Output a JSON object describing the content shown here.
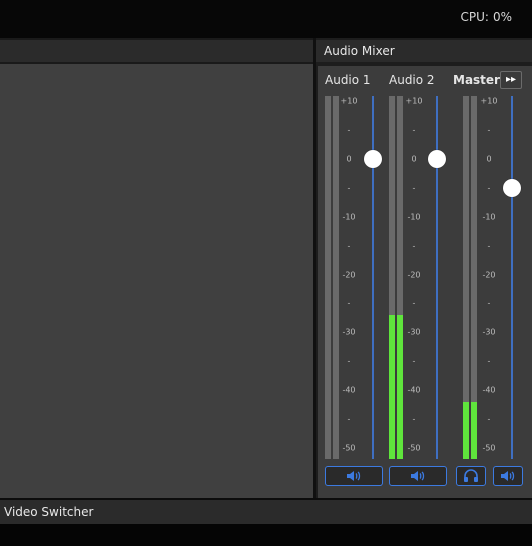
{
  "topbar": {
    "cpu_label": "CPU:",
    "cpu_value": "0%"
  },
  "mixer": {
    "title": "Audio Mixer",
    "expand_icon": "double-chevron-right-icon",
    "scale_labels": [
      "+10",
      "-",
      "0",
      "-",
      "-10",
      "-",
      "-20",
      "-",
      "-30",
      "-",
      "-40",
      "-",
      "-50"
    ],
    "channels": [
      {
        "label": "Audio 1",
        "level_db": -60,
        "fader_db": 0,
        "button_icon": "speaker-icon"
      },
      {
        "label": "Audio 2",
        "level_db": -27,
        "fader_db": 0,
        "button_icon": "speaker-icon"
      },
      {
        "label": "Master",
        "level_db": -42,
        "fader_db": -5,
        "buttons": [
          "headphones-icon",
          "speaker-icon"
        ]
      }
    ]
  },
  "bottom": {
    "video_switcher_title": "Video Switcher"
  },
  "colors": {
    "meter_green": "#5fe53c",
    "fader_track_blue": "#3f6fc1",
    "button_border_blue": "#3c7ae0"
  }
}
